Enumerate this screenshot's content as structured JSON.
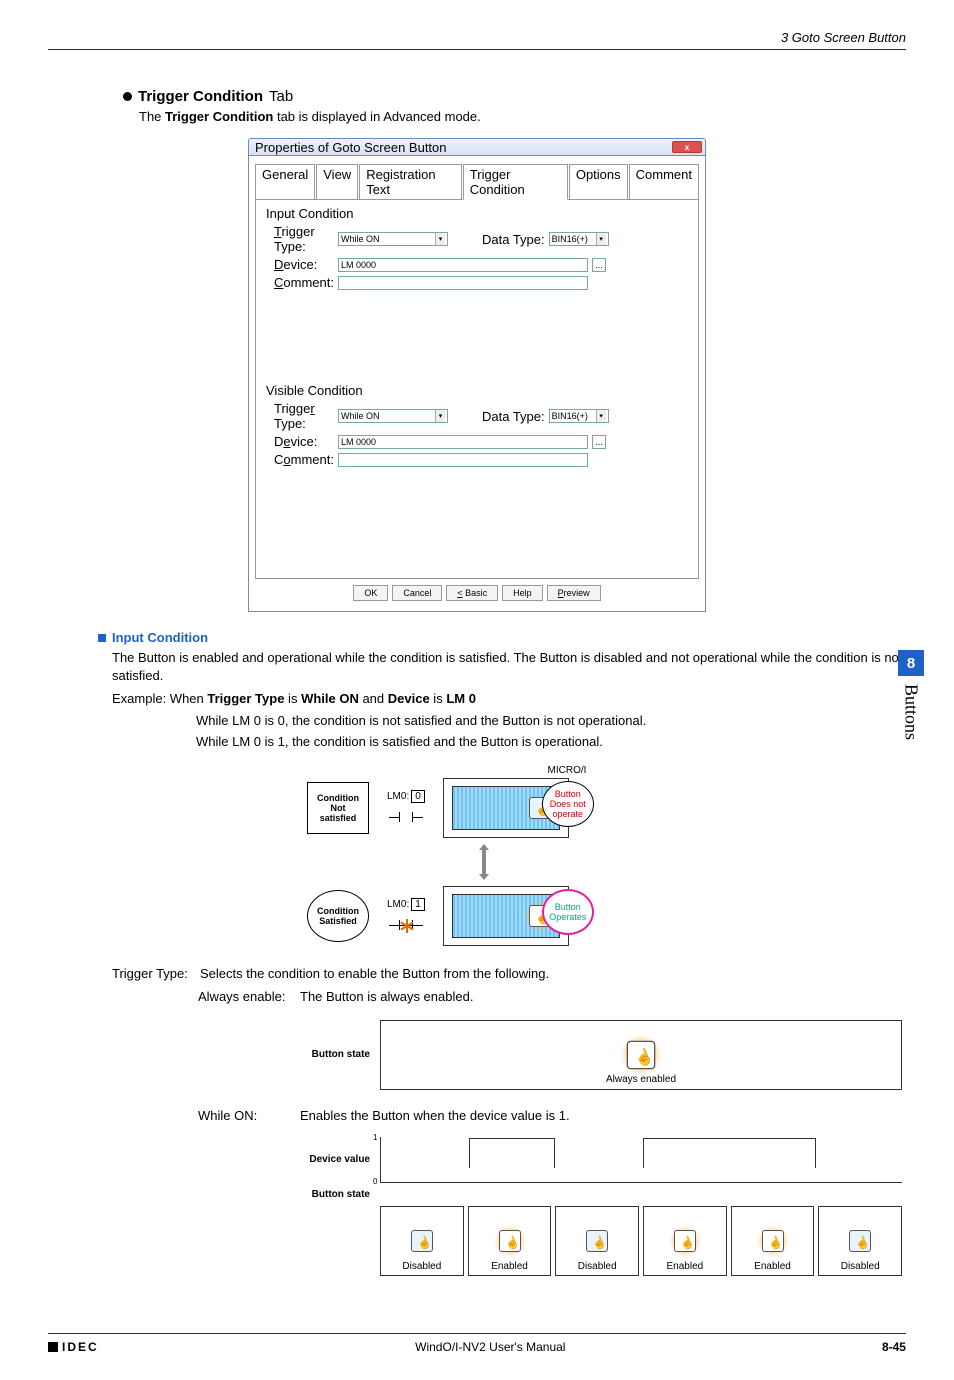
{
  "header": {
    "right": "3 Goto Screen Button"
  },
  "section": {
    "title_bold": "Trigger Condition",
    "title_rest": " Tab",
    "sub_pre": "The ",
    "sub_bold": "Trigger Condition",
    "sub_post": " tab is displayed in Advanced mode."
  },
  "dialog": {
    "title": "Properties of Goto Screen Button",
    "tabs": [
      "General",
      "View",
      "Registration Text",
      "Trigger Condition",
      "Options",
      "Comment"
    ],
    "group1": "Input Condition",
    "group2": "Visible Condition",
    "labels": {
      "trigger_type": "Trigger Type:",
      "device": "Device:",
      "comment": "Comment:",
      "data_type": "Data Type:"
    },
    "values": {
      "trigger_type": "While ON",
      "device": "LM 0000",
      "data_type": "BIN16(+)"
    },
    "buttons": [
      "OK",
      "Cancel",
      "< Basic",
      "Help",
      "Preview"
    ]
  },
  "input_cond": {
    "head": "Input Condition",
    "p1": "The Button is enabled and operational while the condition is satisfied. The Button is disabled and not operational while the condition is not satisfied.",
    "ex_pre": "Example: When ",
    "ex_b1": "Trigger Type",
    "ex_mid1": " is ",
    "ex_b2": "While ON",
    "ex_mid2": " and ",
    "ex_b3": "Device",
    "ex_mid3": " is ",
    "ex_b4": "LM 0",
    "ex_l1": "While LM 0 is 0, the condition is not satisfied and the Button is not operational.",
    "ex_l2": "While LM 0 is 1, the condition is satisfied and the Button is operational."
  },
  "diag": {
    "microi": "MICRO/I",
    "cond_not": "Condition Not satisfied",
    "cond_sat": "Condition Satisfied",
    "lm0": "LM0:",
    "v0": "0",
    "v1": "1",
    "bubble_no": "Button Does not operate",
    "bubble_yes": "Button Operates"
  },
  "trigger_type": {
    "k": "Trigger Type:",
    "v": "Selects the condition to enable the Button from the following."
  },
  "always": {
    "k": "Always enable:",
    "v": "The Button is always enabled.",
    "state": "Button state",
    "caption": "Always enabled"
  },
  "while_on": {
    "k": "While ON:",
    "v": "Enables the Button when the device value is 1.",
    "dev": "Device value",
    "state": "Button state",
    "y1": "1",
    "y0": "0",
    "cells": [
      "Disabled",
      "Enabled",
      "Disabled",
      "Enabled",
      "Enabled",
      "Disabled"
    ]
  },
  "side": {
    "num": "8",
    "txt": "Buttons"
  },
  "footer": {
    "brand": "IDEC",
    "center": "WindO/I-NV2 User's Manual",
    "page": "8-45"
  }
}
